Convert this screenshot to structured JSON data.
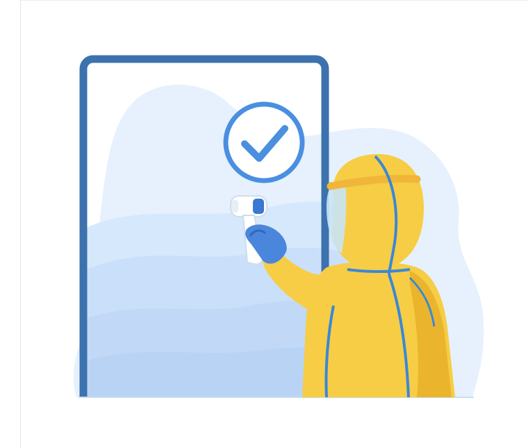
{
  "illustration": {
    "subject": "thermometer-check-illustration",
    "status_icon": "checkmark-circle-icon",
    "colors": {
      "frame": "#3c72ad",
      "background_light": "#e6f1fd",
      "background_mid": "#cfe3fb",
      "wave": "#b9d6f6",
      "check": "#4a8fe0",
      "glove": "#4a86db",
      "suit": "#f6cd45",
      "suit_shadow": "#e9b729",
      "suit_seam": "#3b87d8",
      "visor_band": "#f0b63a",
      "visor": "#c9e4f5"
    }
  }
}
